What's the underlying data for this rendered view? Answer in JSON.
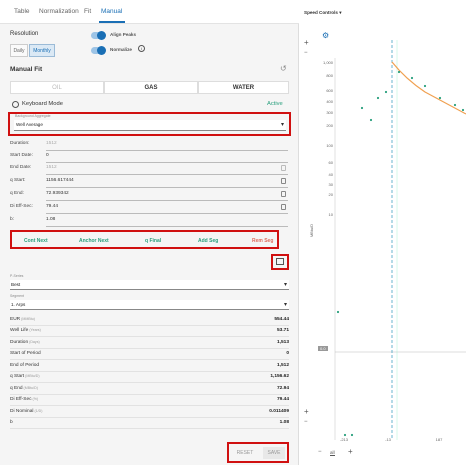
{
  "tabs": [
    "Table",
    "Normalization",
    "Fit",
    "Manual"
  ],
  "resolution": {
    "label": "Resolution",
    "options": [
      "Daily",
      "Monthly"
    ],
    "selected": "Monthly"
  },
  "toggles": {
    "align_peaks": "Align Peaks",
    "normalize": "Normalize"
  },
  "manual_fit": {
    "title": "Manual Fit"
  },
  "phases": [
    "OIL",
    "GAS",
    "WATER"
  ],
  "selected_phase": "GAS",
  "keyboard_mode": {
    "label": "Keyboard Mode",
    "status": "Active"
  },
  "background_aggregate": {
    "label": "Background Aggregate",
    "value": "Well Average"
  },
  "fields": [
    {
      "label": "Duration:",
      "value": "1512"
    },
    {
      "label": "Start Date:",
      "value": "0"
    },
    {
      "label": "End Date:",
      "value": "1512"
    },
    {
      "label": "q Start:",
      "value": "1156.617444"
    },
    {
      "label": "q End:",
      "value": "72.939342"
    },
    {
      "label": "Di Eff-Sec:",
      "value": "79.44"
    },
    {
      "label": "b:",
      "value": "1.08"
    }
  ],
  "actions": [
    "Cont Next",
    "Anchor Next",
    "q Final",
    "Add Seg",
    "Rem Seg"
  ],
  "pseries": {
    "label": "P-Series",
    "value": "Best"
  },
  "segment": {
    "label": "Segment",
    "value": "1. Arps"
  },
  "results": [
    {
      "label": "EUR",
      "unit": "(MMBtu)",
      "value": "554.44"
    },
    {
      "label": "Well Life",
      "unit": "(Years)",
      "value": "53.71"
    },
    {
      "label": "Duration",
      "unit": "(Days)",
      "value": "1,513"
    },
    {
      "label": "Start of Period",
      "unit": "",
      "value": "0"
    },
    {
      "label": "End of Period",
      "unit": "",
      "value": "1,512"
    },
    {
      "label": "q Start",
      "unit": "(MBtu/D)",
      "value": "1,156.62"
    },
    {
      "label": "q End",
      "unit": "(MBtu/D)",
      "value": "72.94"
    },
    {
      "label": "Di Eff-Sec",
      "unit": "(%)",
      "value": "79.44"
    },
    {
      "label": "Di Nominal",
      "unit": "(1/D)",
      "value": "0.011409"
    },
    {
      "label": "b",
      "unit": "",
      "value": "1.08"
    }
  ],
  "buttons": {
    "reset": "RESET",
    "save": "SAVE"
  },
  "chart": {
    "title": "Speed Controls",
    "ylabel": "MBtu/D",
    "yticks": [
      "1,000",
      "800",
      "600",
      "400",
      "300",
      "200",
      "100",
      "60",
      "40",
      "30",
      "20",
      "10"
    ],
    "xticks": [
      "-213",
      "-13",
      "187"
    ],
    "range_label": "all",
    "marker": "0.0"
  },
  "colors": {
    "accent": "#1a6fb5",
    "red_box": "#d01010",
    "green": "#2aa07e",
    "fit_line": "#f0a050"
  }
}
